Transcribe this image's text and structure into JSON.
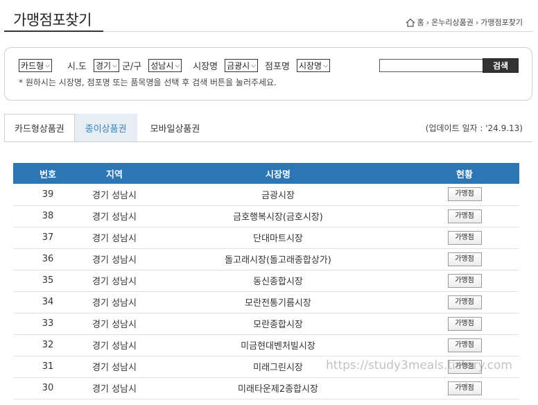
{
  "header": {
    "title": "가맹점포찾기",
    "breadcrumb": [
      "홈",
      "온누리상품권",
      "가맹점포찾기"
    ]
  },
  "search": {
    "card_type": "카드형",
    "sido_label": "시.도",
    "sido_value": "경기",
    "gungu_label": "군/구",
    "gungu_value": "성남시",
    "market_label": "시장명",
    "market_value": "금광시",
    "store_label": "점포명",
    "store_value": "시장명",
    "input_value": "",
    "button_label": "검색",
    "hint": "* 원하시는 시장명, 점포명 또는 품목명을 선택 후 검색 버튼을 눌러주세요."
  },
  "tabs": [
    {
      "label": "카드형상품권"
    },
    {
      "label": "종이상품권"
    },
    {
      "label": "모바일상품권"
    }
  ],
  "update_text": "(업데이트 일자 : '24.9.13)",
  "table": {
    "headers": [
      "번호",
      "지역",
      "시장명",
      "현황"
    ],
    "rows": [
      {
        "no": "39",
        "region": "경기 성남시",
        "market": "금광시장",
        "status": "가맹점"
      },
      {
        "no": "38",
        "region": "경기 성남시",
        "market": "금호행복시장(금호시장)",
        "status": "가맹점"
      },
      {
        "no": "37",
        "region": "경기 성남시",
        "market": "단대마트시장",
        "status": "가맹점"
      },
      {
        "no": "36",
        "region": "경기 성남시",
        "market": "돌고래시장(돌고래종합상가)",
        "status": "가맹점"
      },
      {
        "no": "35",
        "region": "경기 성남시",
        "market": "동신종합시장",
        "status": "가맹점"
      },
      {
        "no": "34",
        "region": "경기 성남시",
        "market": "모란전통기름시장",
        "status": "가맹점"
      },
      {
        "no": "33",
        "region": "경기 성남시",
        "market": "모란종합시장",
        "status": "가맹점"
      },
      {
        "no": "32",
        "region": "경기 성남시",
        "market": "미금현대벤처빌시장",
        "status": "가맹점"
      },
      {
        "no": "31",
        "region": "경기 성남시",
        "market": "미래그린시장",
        "status": "가맹점"
      },
      {
        "no": "30",
        "region": "경기 성남시",
        "market": "미래타운제2종합시장",
        "status": "가맹점"
      }
    ]
  },
  "watermark": "https://study3meals.tistory.com"
}
